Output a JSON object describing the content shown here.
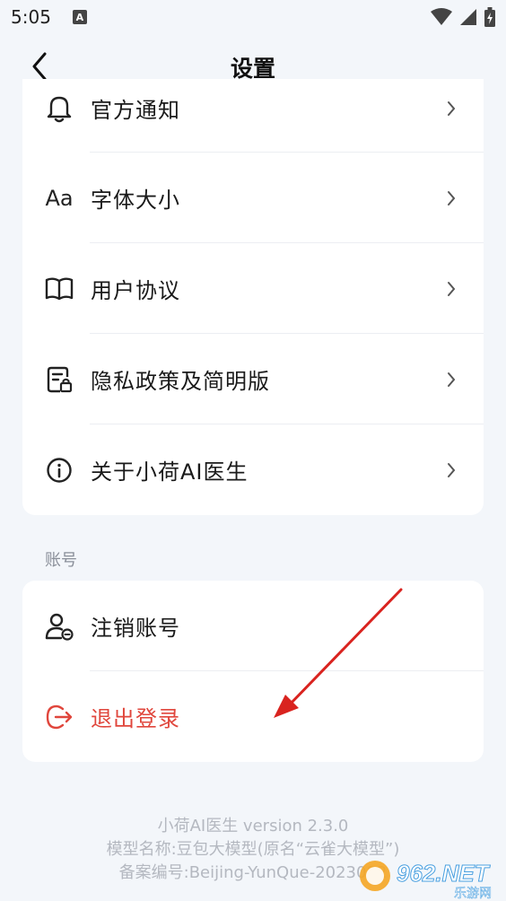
{
  "status": {
    "time": "5:05",
    "notif_letter": "A"
  },
  "header": {
    "title": "设置"
  },
  "menu": {
    "items": [
      {
        "label": "官方通知",
        "icon": "bell-icon"
      },
      {
        "label": "字体大小",
        "icon": "font-size-icon",
        "icon_text": "Aa"
      },
      {
        "label": "用户协议",
        "icon": "book-icon"
      },
      {
        "label": "隐私政策及简明版",
        "icon": "privacy-doc-icon"
      },
      {
        "label": "关于小荷AI医生",
        "icon": "info-icon"
      }
    ]
  },
  "account": {
    "section_label": "账号",
    "items": [
      {
        "label": "注销账号",
        "icon": "user-remove-icon"
      },
      {
        "label": "退出登录",
        "icon": "logout-icon"
      }
    ]
  },
  "footer": {
    "line1": "小荷AI医生 version 2.3.0",
    "line2": "模型名称:豆包大模型(原名“云雀大模型”)",
    "line3": "备案编号:Beijing-YunQue-2023082"
  },
  "watermark": {
    "brand": "962.NET",
    "sub": "乐游网"
  },
  "colors": {
    "logout_red": "#e0463c",
    "background": "#f3f6fa",
    "arrow": "#d9231f"
  }
}
